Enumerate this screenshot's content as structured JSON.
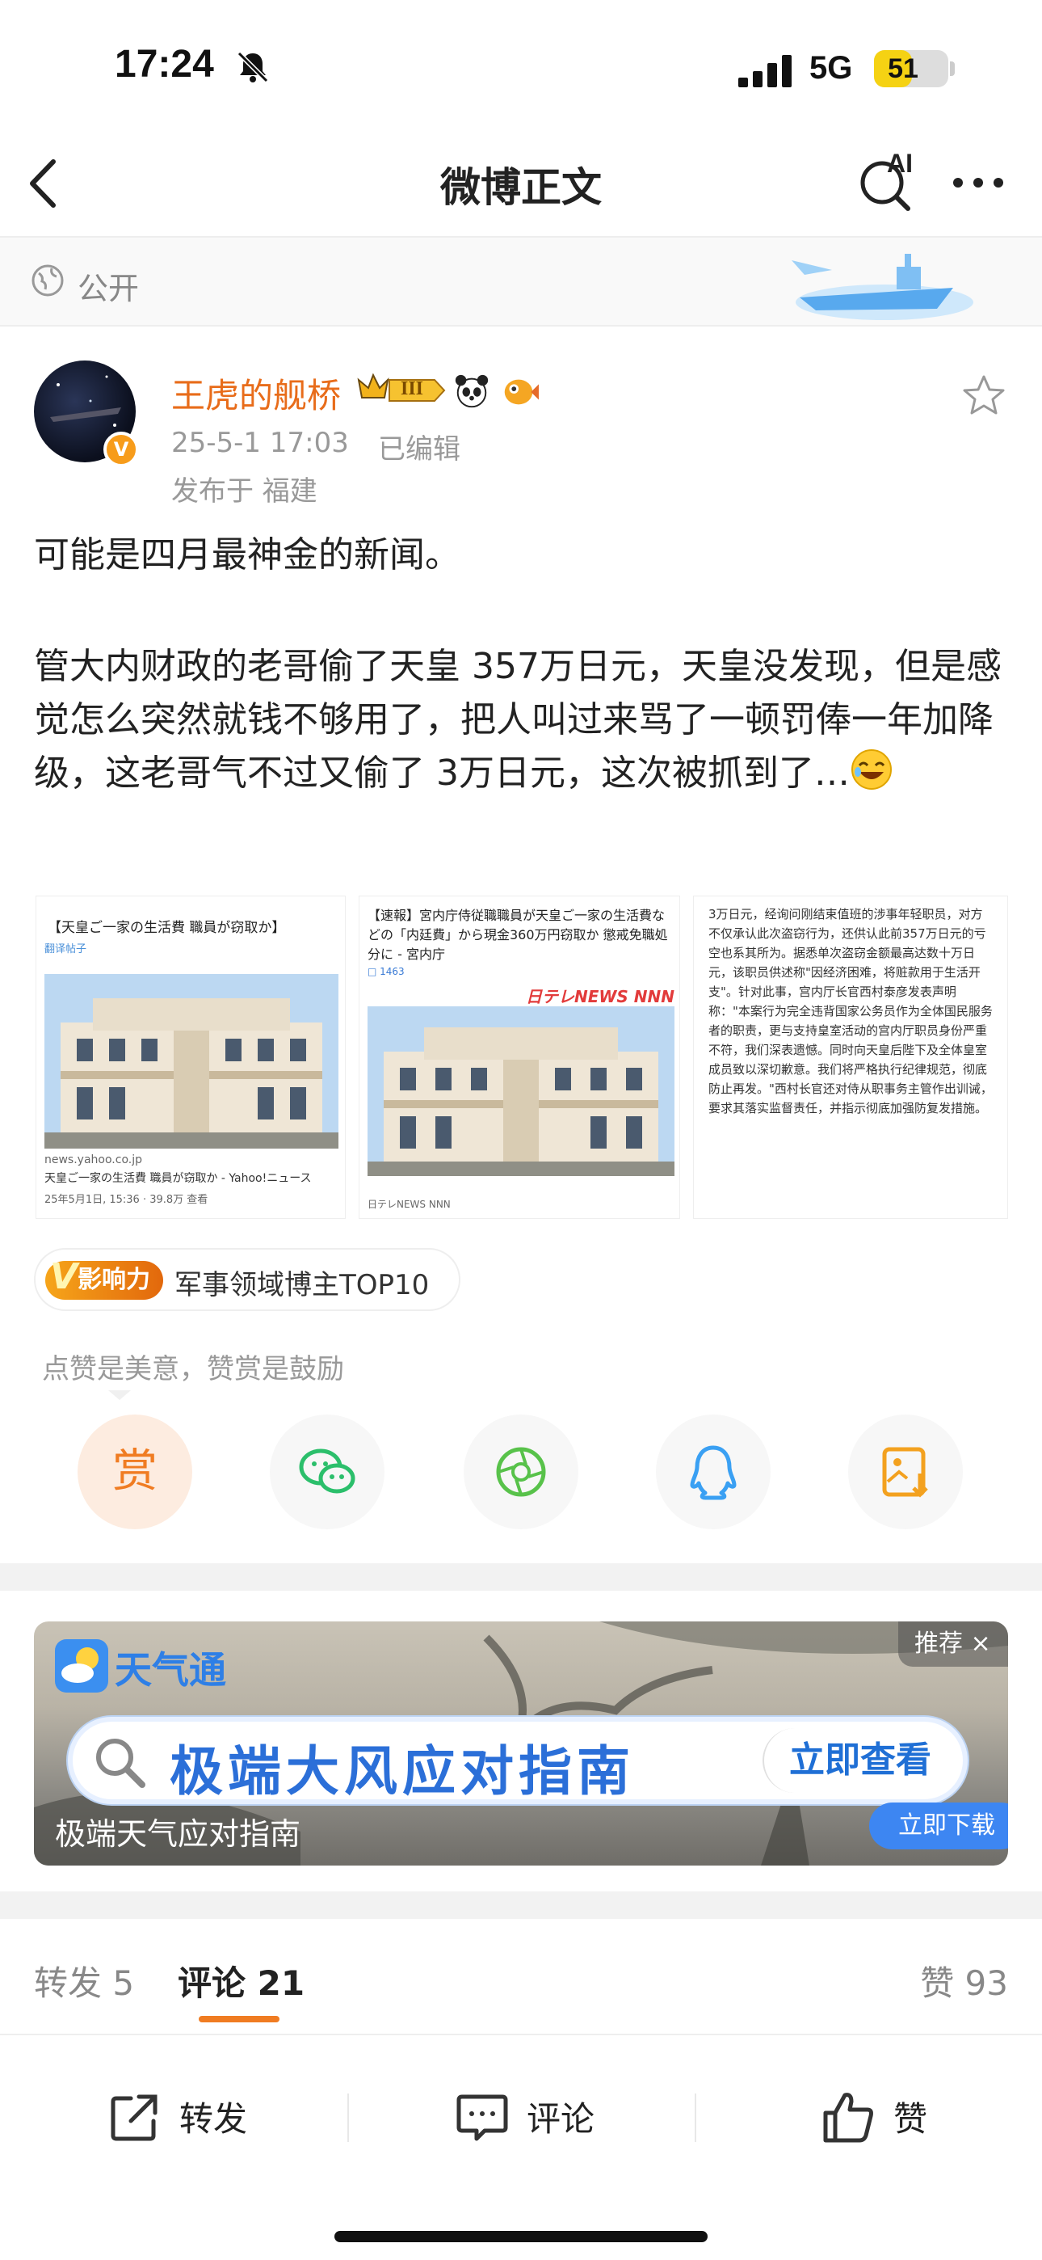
{
  "status_bar": {
    "time": "17:24",
    "network": "5G",
    "battery": "51",
    "battery_level": 0.51
  },
  "nav": {
    "title": "微博正文",
    "ai_label": "AI"
  },
  "visibility": {
    "label": "公开"
  },
  "post": {
    "username": "王虎的舰桥",
    "rank_badge": "III",
    "time": "25-5-1 17:03",
    "edited": "已编辑",
    "location": "发布于 福建",
    "text_line1": "可能是四月最神金的新闻。",
    "text_line2": "管大内财政的老哥偷了天皇 357万日元，天皇没发现，但是感觉怎么突然就钱不够用了，把人叫过来骂了一顿罚俸一年加降级，这老哥气不过又偷了 3万日元，这次被抓到了…"
  },
  "images": {
    "img1": {
      "headline": "【天皇ご一家の生活費 職員が窃取か】",
      "tag": "翻译帖子",
      "domain": "news.yahoo.co.jp",
      "caption": "天皇ご一家の生活費 職員が窃取か - Yahoo!ニュース",
      "meta": "25年5月1日, 15:36 · 39.8万 查看"
    },
    "img2": {
      "headline": "【速報】宮内庁侍従職職員が天皇ご一家の生活費などの「内廷費」から現金360万円窃取か 懲戒免職処分に - 宮内庁",
      "comments": "1463",
      "brand": "日テレNEWS NNN",
      "footer": "日テレNEWS NNN"
    },
    "img3": {
      "text": "3万日元，经询问刚结束值班的涉事年轻职员，对方不仅承认此次盗窃行为，还供认此前357万日元的亏空也系其所为。据悉单次盗窃金额最高达数十万日元，该职员供述称\"因经济困难，将赃款用于生活开支\"。针对此事，宫内厅长官西村泰彦发表声明称：\"本案行为完全违背国家公务员作为全体国民服务者的职责，更与支持皇室活动的宫内厅职员身份严重不符，我们深表遗憾。同时向天皇后陛下及全体皇室成员致以深切歉意。我们将严格执行纪律规范，彻底防止再发。\"西村长官还对侍从职事务主管作出训诫，要求其落实监督责任，并指示彻底加强防复发措施。"
    }
  },
  "influence": {
    "badge": "影响力",
    "text": "军事领域博主TOP10"
  },
  "praise_note": "点赞是美意，赞赏是鼓励",
  "share": {
    "reward_label": "赏",
    "icons": [
      "reward-icon",
      "wechat-icon",
      "moments-icon",
      "qq-icon",
      "save-image-icon"
    ]
  },
  "ad": {
    "brand": "天气通",
    "tag": "推荐 ×",
    "headline": "极端大风应对指南",
    "cta": "立即查看",
    "subtitle": "极端天气应对指南",
    "download": "立即下载"
  },
  "tabs": {
    "repost": "转发 5",
    "comment": "评论 21",
    "like": "赞 93"
  },
  "actions": {
    "repost": "转发",
    "comment": "评论",
    "like": "赞"
  },
  "colors": {
    "accent": "#f07c22",
    "username": "#e86c1a",
    "ad_blue": "#2b6fd8"
  }
}
